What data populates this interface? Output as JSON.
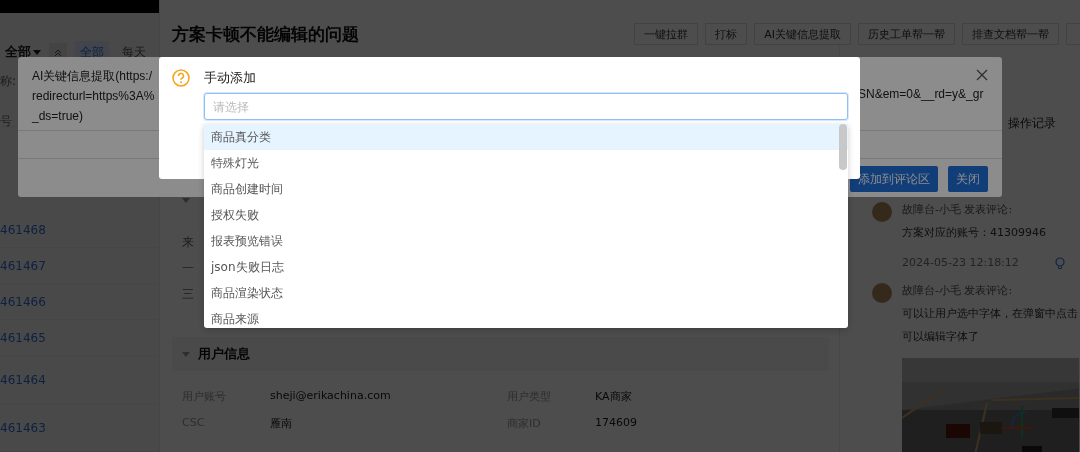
{
  "sidebar": {
    "filter": "全部",
    "tabs": [
      {
        "label": "全部",
        "selected": true
      },
      {
        "label": "每天",
        "selected": false
      }
    ],
    "field_label": "称:",
    "column_header": "号",
    "ids": [
      "461468",
      "461467",
      "461466",
      "461465",
      "461464",
      "461463"
    ]
  },
  "ticket": {
    "title": "方案卡顿不能编辑的问题",
    "actions": [
      "一键拉群",
      "打标",
      "AI关键信息提取",
      "历史工单帮一帮",
      "排查文档帮一帮"
    ],
    "basic_section": {
      "rows": [
        "来",
        "一",
        "三"
      ]
    },
    "user_section": {
      "title": "用户信息",
      "expanded": true,
      "fields": [
        {
          "label": "用户账号",
          "value": "sheji@erikachina.com"
        },
        {
          "label": "用户类型",
          "value": "KA商家"
        },
        {
          "label": "CSC",
          "value": "雁南"
        },
        {
          "label": "商家ID",
          "value": "174609"
        }
      ]
    }
  },
  "activity": {
    "tab": "操作记录",
    "comments": [
      {
        "author": "故障台-小毛 发表评论:",
        "text": "方案对应的账号：41309946",
        "time": "2024-05-23 12:18:12"
      },
      {
        "author": "故障台-小毛 发表评论:",
        "text": "可以让用户选中字体，在弹窗中点击",
        "text_2": "可以编辑字体了"
      }
    ]
  },
  "ai_dialog": {
    "lines": [
      "AI关键信息提取(https:/",
      "redirecturl=https%3A%",
      "_ds=true)"
    ],
    "line_right": "SN&em=0&__rd=y&_gr",
    "buttons": [
      {
        "label": "添加到评论区"
      },
      {
        "label": "关闭"
      }
    ]
  },
  "manual_dialog": {
    "title": "手动添加",
    "placeholder": "请选择",
    "options": [
      {
        "label": "商品真分类",
        "selected": true
      },
      {
        "label": "特殊灯光",
        "selected": false
      },
      {
        "label": "商品创建时间",
        "selected": false
      },
      {
        "label": "授权失败",
        "selected": false
      },
      {
        "label": "报表预览错误",
        "selected": false
      },
      {
        "label": "json失败日志",
        "selected": false
      },
      {
        "label": "商品渲染状态",
        "selected": false
      },
      {
        "label": "商品来源",
        "selected": false
      }
    ]
  }
}
